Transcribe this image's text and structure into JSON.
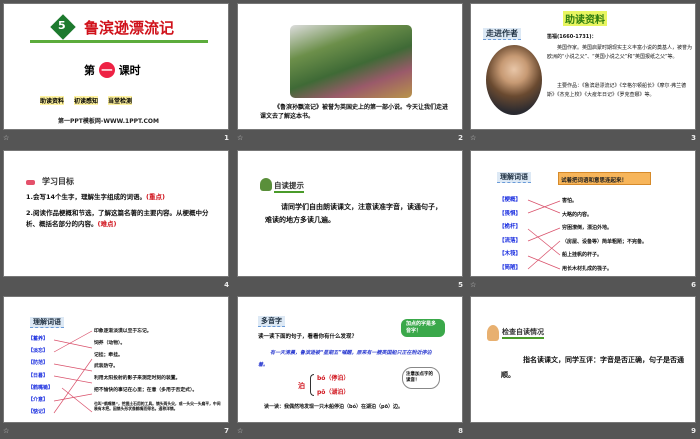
{
  "slides": [
    {
      "number": "1",
      "title": "鲁滨逊漂流记",
      "unit_badge": "5",
      "lesson_prefix": "第",
      "lesson_num": "一",
      "lesson_suffix": "课时",
      "links": [
        "助读资料",
        "初读感知",
        "当堂检测"
      ],
      "footer": "第一PPT模板网-WWW.1PPT.COM"
    },
    {
      "number": "2",
      "caption": "《鲁滨孙飘流记》被誉为英国史上的第一部小说。今天让我们走进课文去了解这本书。"
    },
    {
      "number": "3",
      "title": "助读资料",
      "tag": "走进作者",
      "author": "笛福(1660-1731)：",
      "bio": "英国作家。英国启蒙时期现实主义丰富小说的奠基人，被誉为欧洲的“小说之父”、“英国小说之父”和“英国报纸之父”等。",
      "works": "主要作品：《鲁滨逊漂流记》《辛格尔顿船长》《摩尔·弗兰德斯》《杰克上校》《大疫年日记》《罗克查娜》等。"
    },
    {
      "number": "4",
      "heading": "学习目标",
      "goal1": "1.会写14个生字，理解生字组成的词语。",
      "goal1_tag": "(重点)",
      "goal2": "2.阅读作品梗概和节选，了解这篇名著的主要内容。从梗概中分析、概括名部分的内容。",
      "goal2_tag": "(难点)"
    },
    {
      "number": "5",
      "heading": "自读提示",
      "body": "请同学们自由朗读课文，注意读准字音，读通句子，难读的地方多读几遍。"
    },
    {
      "number": "6",
      "heading": "理解词语",
      "banner": "试着把词语和意思连起来！",
      "words": [
        "【梗概】",
        "【畏惧】",
        "【桅杆】",
        "【流落】",
        "【木筏】",
        "【简陋】"
      ],
      "meanings": [
        "害怕。",
        "大略的内容。",
        "穷困潦倒，漂泊外地。",
        "（房屋、设备等）简单粗陋；不完备。",
        "船上挂帆的杆子。",
        "用长木材扎成的筏子。"
      ]
    },
    {
      "number": "7",
      "heading": "理解词语",
      "words": [
        "【蓄养】",
        "【淡忘】",
        "【防范】",
        "【日晷】",
        "【鹤嘴锄】",
        "【介意】",
        "【惦记】"
      ],
      "meanings": [
        "印象逐渐淡漠以至于忘记。",
        "饲养（动物）。",
        "记挂；牵挂。",
        "武装防守。",
        "利用太阳投射的影子来测定时刻的装置。",
        "把不愉快的事记在心里；在意（多用于否定式）。",
        "也叫“鹤嘴镐”，挖掘土石用的工具。镐头两头尖，或一头尖一头扁平，中间装有木把。因镐头形状像鹤嘴而得名。通称洋镐。"
      ]
    },
    {
      "number": "8",
      "heading": "多音字",
      "prompt": "读一读下面的句子，看看你有什么发现？",
      "bubble": "加点的字是多音字！",
      "cloud": "注意加点字的读音！",
      "sentence": "有一天清晨，鲁滨逊被“星期五”喊醒，原来有一艘英国船只正在附近停泊着。",
      "char": "泊",
      "reading1": "bó（停泊）",
      "reading2": "pō（湖泊）",
      "practice": "读一读：我偶然地发现一只木船停泊（bó）在湖泊（pō）边。"
    },
    {
      "number": "9",
      "heading": "检查自读情况",
      "body": "指名读课文，同学互评：字音是否正确，句子是否通顺。"
    }
  ],
  "anim_icon": "☆"
}
